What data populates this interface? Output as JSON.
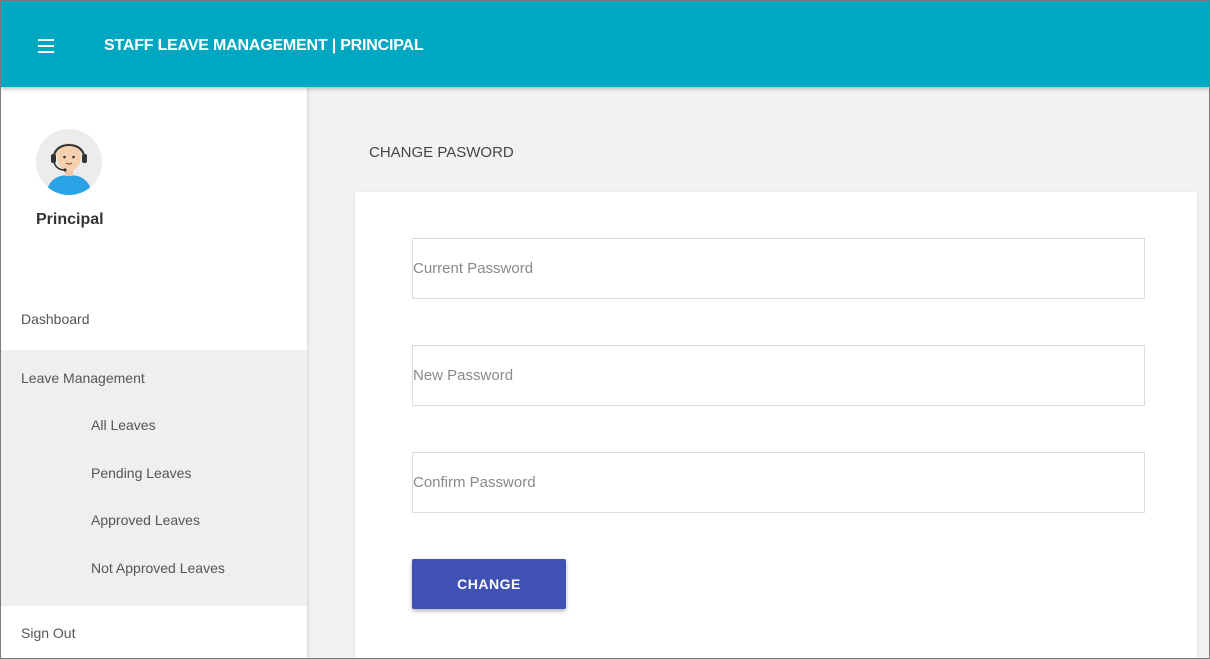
{
  "header": {
    "title": "STAFF LEAVE MANAGEMENT | PRINCIPAL",
    "menu_icon": "hamburger-menu-icon",
    "background": "#00a7c1"
  },
  "sidebar": {
    "profile": {
      "name": "Principal",
      "avatar_icon": "support-agent-avatar"
    },
    "items": [
      {
        "label": "Dashboard"
      },
      {
        "label": "Leave Management",
        "children": [
          {
            "label": "All Leaves"
          },
          {
            "label": "Pending Leaves"
          },
          {
            "label": "Approved Leaves"
          },
          {
            "label": "Not Approved Leaves"
          }
        ]
      },
      {
        "label": "Sign Out"
      }
    ]
  },
  "main": {
    "heading": "CHANGE PASWORD",
    "form": {
      "current_password": {
        "value": "",
        "placeholder": "Current Password"
      },
      "new_password": {
        "value": "",
        "placeholder": "New Password"
      },
      "confirm_password": {
        "value": "",
        "placeholder": "Confirm Password"
      },
      "submit_label": "CHANGE",
      "submit_color": "#3f51b5"
    }
  }
}
